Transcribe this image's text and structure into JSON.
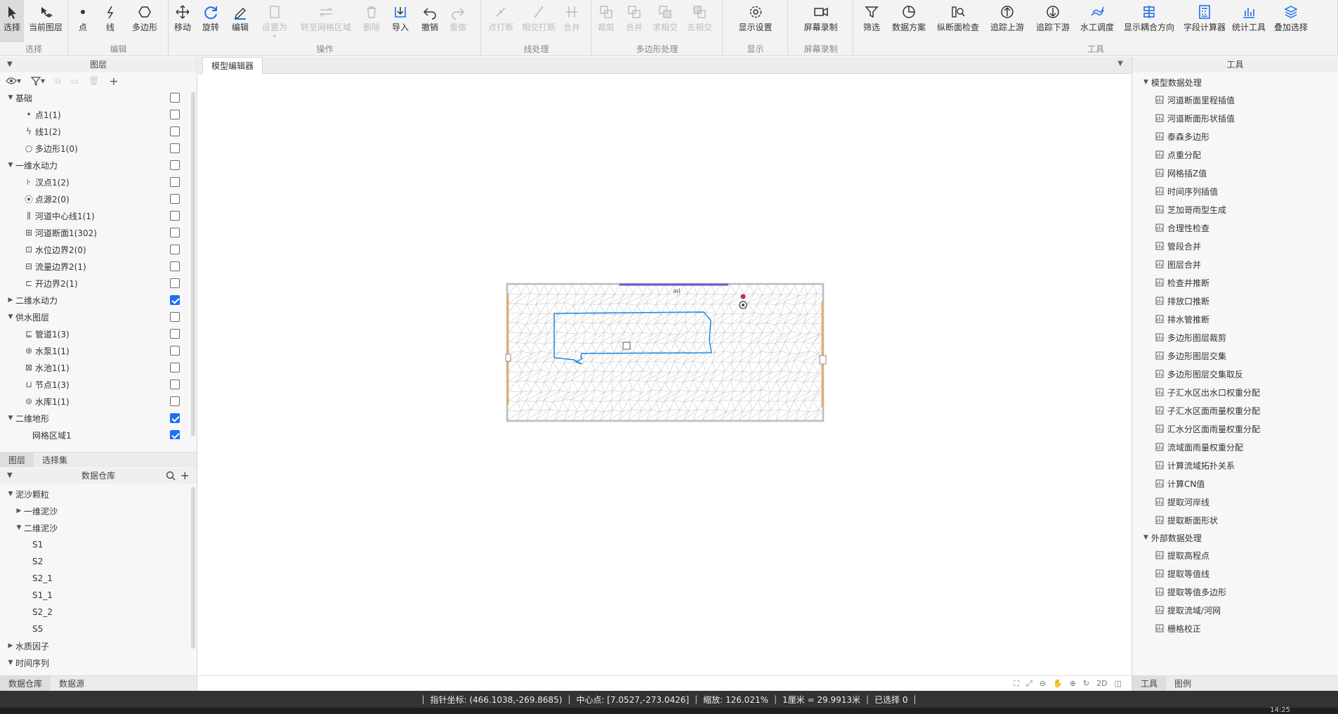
{
  "ribbon": {
    "groups": [
      {
        "label": "选择",
        "buttons": [
          {
            "label": "选择",
            "icon": "cursor-icon"
          },
          {
            "label": "当前图层",
            "icon": "current-layer-icon"
          }
        ]
      },
      {
        "label": "编辑",
        "buttons": [
          {
            "label": "点",
            "icon": "point-icon"
          },
          {
            "label": "线",
            "icon": "line-icon"
          },
          {
            "label": "多边形",
            "icon": "polygon-icon"
          }
        ]
      },
      {
        "label": "操作",
        "buttons": [
          {
            "label": "移动",
            "icon": "move-icon"
          },
          {
            "label": "旋转",
            "icon": "rotate-icon"
          },
          {
            "label": "编辑",
            "icon": "pen-icon"
          },
          {
            "label": "设置为",
            "icon": "set-as-icon"
          },
          {
            "label": "转至网格区域",
            "icon": "to-mesh-icon"
          },
          {
            "label": "删除",
            "icon": "trash-icon"
          },
          {
            "label": "导入",
            "icon": "import-icon"
          },
          {
            "label": "撤销",
            "icon": "undo-icon"
          },
          {
            "label": "重做",
            "icon": "redo-icon"
          }
        ]
      },
      {
        "label": "线处理",
        "buttons": [
          {
            "label": "点打断",
            "icon": "point-break-icon"
          },
          {
            "label": "相交打断",
            "icon": "intersect-break-icon"
          },
          {
            "label": "合并",
            "icon": "merge-line-icon"
          }
        ]
      },
      {
        "label": "多边形处理",
        "buttons": [
          {
            "label": "裁剪",
            "icon": "clip-icon"
          },
          {
            "label": "合并",
            "icon": "union-icon"
          },
          {
            "label": "求相交",
            "icon": "intersect-icon"
          },
          {
            "label": "去相交",
            "icon": "remove-intersect-icon"
          }
        ]
      },
      {
        "label": "显示",
        "buttons": [
          {
            "label": "显示设置",
            "icon": "gear-icon"
          }
        ]
      },
      {
        "label": "屏幕录制",
        "buttons": [
          {
            "label": "屏幕录制",
            "icon": "video-icon"
          }
        ]
      },
      {
        "label": "工具",
        "buttons": [
          {
            "label": "筛选",
            "icon": "filter-icon"
          },
          {
            "label": "数据方案",
            "icon": "pie-icon"
          },
          {
            "label": "纵断面检查",
            "icon": "profile-check-icon"
          },
          {
            "label": "追踪上游",
            "icon": "trace-up-icon"
          },
          {
            "label": "追踪下游",
            "icon": "trace-down-icon"
          },
          {
            "label": "水工调度",
            "icon": "hydro-dispatch-icon"
          },
          {
            "label": "显示耦合方向",
            "icon": "coupling-icon"
          },
          {
            "label": "字段计算器",
            "icon": "calculator-icon"
          },
          {
            "label": "统计工具",
            "icon": "stats-icon"
          },
          {
            "label": "叠加选择",
            "icon": "layers-icon"
          }
        ]
      }
    ]
  },
  "layers_panel": {
    "title": "图层",
    "rows": [
      {
        "label": "基础",
        "level": 0,
        "twisty": "▼",
        "icon": "",
        "checked": false
      },
      {
        "label": "点1(1)",
        "level": 1,
        "twisty": "",
        "icon": "•",
        "checked": false
      },
      {
        "label": "线1(2)",
        "level": 1,
        "twisty": "",
        "icon": "ϟ",
        "checked": false
      },
      {
        "label": "多边形1(0)",
        "level": 1,
        "twisty": "",
        "icon": "○",
        "checked": false
      },
      {
        "label": "一维水动力",
        "level": 0,
        "twisty": "▼",
        "icon": "",
        "checked": false
      },
      {
        "label": "汊点1(2)",
        "level": 1,
        "twisty": "",
        "icon": "⊦",
        "checked": false
      },
      {
        "label": "点源2(0)",
        "level": 1,
        "twisty": "",
        "icon": "⦿",
        "checked": false
      },
      {
        "label": "河道中心线1(1)",
        "level": 1,
        "twisty": "",
        "icon": "⫼",
        "checked": false
      },
      {
        "label": "河道断面1(302)",
        "level": 1,
        "twisty": "",
        "icon": "⊞",
        "checked": false
      },
      {
        "label": "水位边界2(0)",
        "level": 1,
        "twisty": "",
        "icon": "⊡",
        "checked": false
      },
      {
        "label": "流量边界2(1)",
        "level": 1,
        "twisty": "",
        "icon": "⊟",
        "checked": false
      },
      {
        "label": "开边界2(1)",
        "level": 1,
        "twisty": "",
        "icon": "⊏",
        "checked": false
      },
      {
        "label": "二维水动力",
        "level": 0,
        "twisty": "▶",
        "icon": "",
        "checked": true
      },
      {
        "label": "供水图层",
        "level": 0,
        "twisty": "▼",
        "icon": "",
        "checked": false
      },
      {
        "label": "管道1(3)",
        "level": 1,
        "twisty": "",
        "icon": "⊑",
        "checked": false
      },
      {
        "label": "水泵1(1)",
        "level": 1,
        "twisty": "",
        "icon": "⊛",
        "checked": false
      },
      {
        "label": "水池1(1)",
        "level": 1,
        "twisty": "",
        "icon": "⊠",
        "checked": false
      },
      {
        "label": "节点1(3)",
        "level": 1,
        "twisty": "",
        "icon": "⊔",
        "checked": false
      },
      {
        "label": "水库1(1)",
        "level": 1,
        "twisty": "",
        "icon": "⊜",
        "checked": false
      },
      {
        "label": "二维地形",
        "level": 0,
        "twisty": "▼",
        "icon": "",
        "checked": true
      },
      {
        "label": "网格区域1",
        "level": 2,
        "twisty": "",
        "icon": "",
        "checked": true
      }
    ],
    "tabs": [
      "图层",
      "选择集"
    ]
  },
  "data_panel": {
    "title": "数据仓库",
    "rows": [
      {
        "label": "泥沙颗粒",
        "level": 0,
        "twisty": "▼"
      },
      {
        "label": "一维泥沙",
        "level": 1,
        "twisty": "▶"
      },
      {
        "label": "二维泥沙",
        "level": 1,
        "twisty": "▼"
      },
      {
        "label": "S1",
        "level": 2,
        "twisty": ""
      },
      {
        "label": "S2",
        "level": 2,
        "twisty": ""
      },
      {
        "label": "S2_1",
        "level": 2,
        "twisty": ""
      },
      {
        "label": "S1_1",
        "level": 2,
        "twisty": ""
      },
      {
        "label": "S2_2",
        "level": 2,
        "twisty": ""
      },
      {
        "label": "S5",
        "level": 2,
        "twisty": ""
      },
      {
        "label": "水质因子",
        "level": 0,
        "twisty": "▶"
      },
      {
        "label": "时间序列",
        "level": 0,
        "twisty": "▼"
      }
    ],
    "tabs": [
      "数据仓库",
      "数据源"
    ]
  },
  "editor": {
    "tab": "模型编辑器",
    "footer_mode": "2D"
  },
  "tools_panel": {
    "title": "工具",
    "sections": [
      {
        "label": "模型数据处理",
        "items": [
          "河道断面里程插值",
          "河道断面形状插值",
          "泰森多边形",
          "点重分配",
          "网格插Z值",
          "时间序列插值",
          "芝加哥雨型生成",
          "合理性检查",
          "管段合并",
          "图层合并",
          "检查井推断",
          "排放口推断",
          "排水管推断",
          "多边形图层裁剪",
          "多边形图层交集",
          "多边形图层交集取反",
          "子汇水区出水口权重分配",
          "子汇水区面雨量权重分配",
          "汇水分区面雨量权重分配",
          "流域面雨量权重分配",
          "计算流域拓扑关系",
          "计算CN值",
          "提取河岸线",
          "提取断面形状"
        ]
      },
      {
        "label": "外部数据处理",
        "items": [
          "提取高程点",
          "提取等值线",
          "提取等值多边形",
          "提取流域/河网",
          "栅格校正"
        ]
      }
    ],
    "tabs": [
      "工具",
      "图例"
    ]
  },
  "status": {
    "cursor": "指针坐标: (466.1038,-269.8685)",
    "center": "中心点: [7.0527,-273.0426]",
    "zoom": "缩放: 126.021%",
    "scale": "1厘米 = 29.9913米",
    "selected": "已选择 0"
  },
  "taskbar": {
    "clock": "14:25"
  },
  "colors": {
    "accent": "#1e6ff1",
    "polygon": "#1e88e5",
    "mesh": "#cfcfcf",
    "boundary": "#e0b070",
    "centerline": "#6a5acd",
    "status_bg": "#333333"
  }
}
